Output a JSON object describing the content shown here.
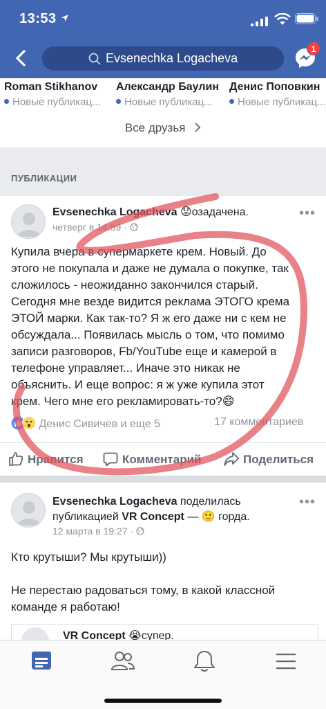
{
  "status_bar": {
    "time": "13:53"
  },
  "nav": {
    "search_text": "Evsenechka Logacheva",
    "messenger_badge": "1"
  },
  "friends": {
    "items": [
      {
        "name": "Roman Stikhanov",
        "subtitle": "Новые публикац..."
      },
      {
        "name": "Александр Баулин",
        "subtitle": "Новые публикац..."
      },
      {
        "name": "Денис Поповкин",
        "subtitle": "Новые публикац..."
      }
    ],
    "all_friends_label": "Все друзья"
  },
  "section": {
    "label": "ПУБЛИКАЦИИ"
  },
  "post1": {
    "author": "Evsenechka Logacheva",
    "feeling": "озадачена.",
    "time": "четверг в 14:59",
    "text": [
      "Купила вчера в супермаркете крем. Новый. До",
      "этого не покупала и даже не думала о покупке, так",
      "сложилось - неожиданно закончился старый.",
      "Сегодня мне везде видится реклама ЭТОГО крема",
      "ЭТОЙ марки. Как так-то? Я ж его даже ни с кем не",
      "обсуждала... Появилась мысль о том, что помимо",
      "записи разговоров, Fb/YouTube еще и камерой в",
      "телефоне управляет... Иначе это никак не",
      "объяснить. И еще вопрос: я ж уже купила этот",
      "крем. Чего мне его рекламировать-то?"
    ],
    "reactions_text": "Денис Сивичев и еще 5",
    "comments_text": "17 комментариев",
    "like_label": "Нравится",
    "comment_label": "Комментарий",
    "share_label": "Поделиться"
  },
  "post2": {
    "author": "Evsenechka Logacheva",
    "shared_text": "поделилась",
    "shared_text2": "публикацией",
    "page": "VR Concept",
    "feeling": "горда.",
    "time": "12 марта в 19:27",
    "line1": "Кто крутыши? Мы крутыши))",
    "line2": "Не перестаю радоваться тому, в какой классной",
    "line3": "команде я работаю!",
    "card_author": "VR Concept",
    "card_feeling": "супер."
  },
  "colors": {
    "brand": "#4267b2",
    "annotation": "#e0505a"
  },
  "icons": [
    "back-icon",
    "search-icon",
    "messenger-icon",
    "globe-icon",
    "like-icon",
    "comment-icon",
    "share-icon",
    "news-feed-icon",
    "friends-icon",
    "notifications-icon",
    "menu-icon"
  ]
}
